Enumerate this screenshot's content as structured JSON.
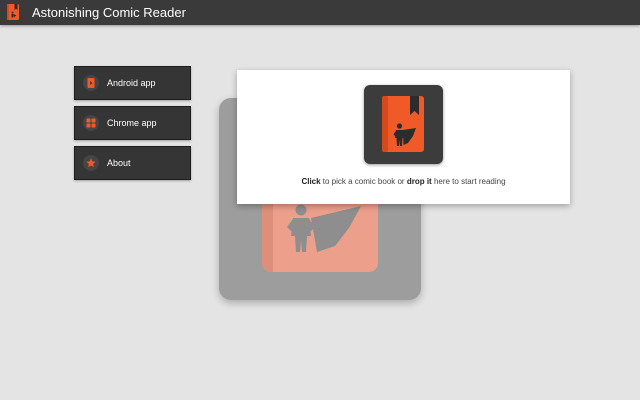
{
  "app": {
    "title": "Astonishing Comic Reader"
  },
  "menu": {
    "items": [
      {
        "id": "android",
        "label": "Android app",
        "icon": "android-phone-icon"
      },
      {
        "id": "chrome",
        "label": "Chrome app",
        "icon": "apps-grid-icon"
      },
      {
        "id": "about",
        "label": "About",
        "icon": "star-icon"
      }
    ]
  },
  "drop_zone": {
    "click_strong": "Click",
    "click_rest": " to pick a comic book or ",
    "drop_strong": "drop it",
    "drop_rest": " here to start reading"
  },
  "colors": {
    "accent": "#f05a28",
    "topbar": "#3a3a3a",
    "menu_bg": "#353535",
    "background": "#e4e4e4"
  }
}
